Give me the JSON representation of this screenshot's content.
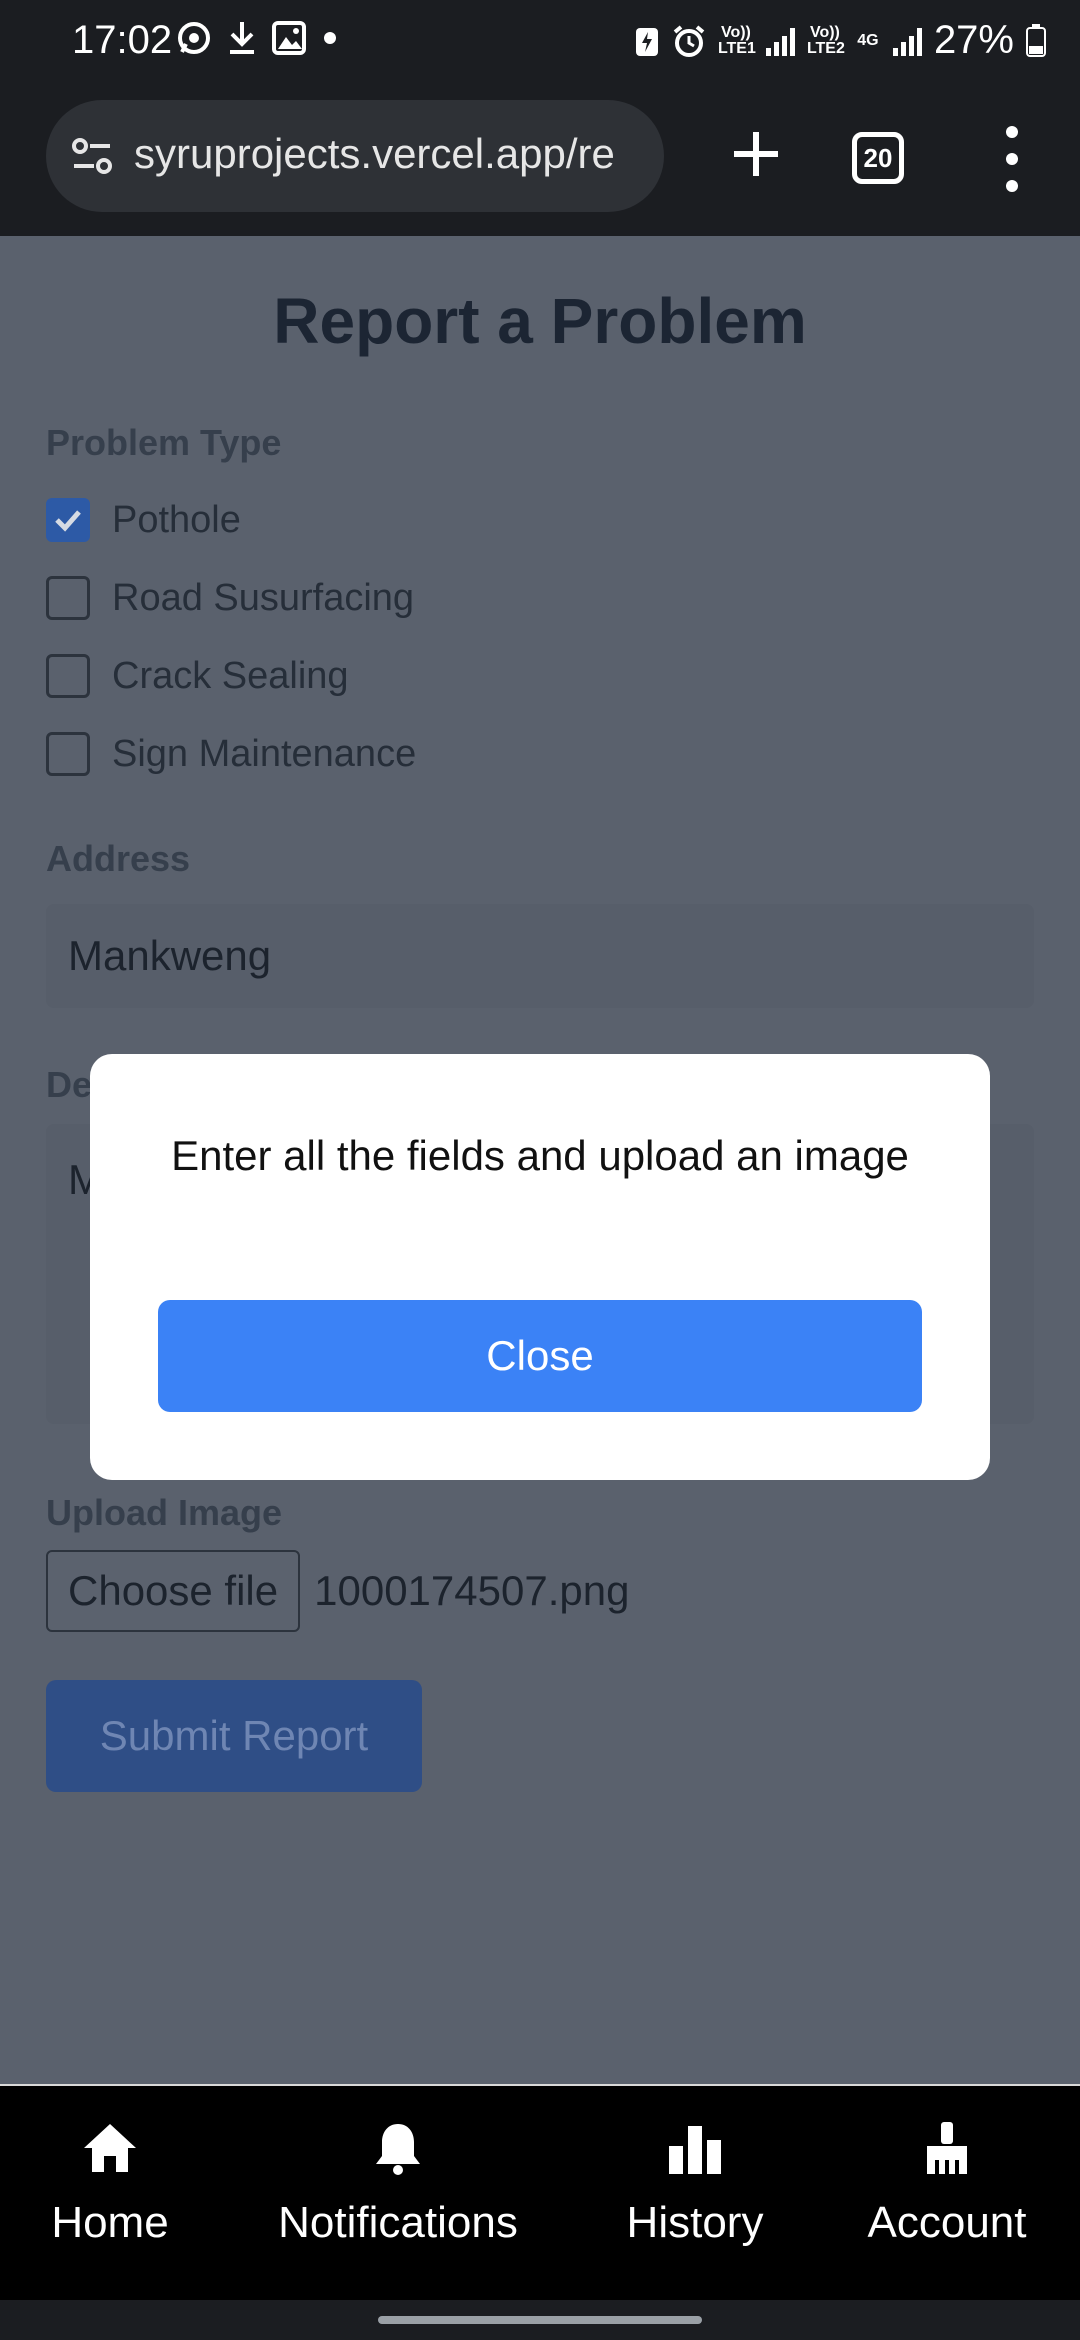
{
  "status_bar": {
    "time": "17:02",
    "battery": "27%",
    "net1": "Vo)) LTE1",
    "net2": "Vo)) LTE2",
    "net3": "4G"
  },
  "browser": {
    "url": "syruprojects.vercel.app/re",
    "tab_count": "20"
  },
  "form": {
    "title": "Report a Problem",
    "problem_type_label": "Problem Type",
    "options": [
      {
        "label": "Pothole",
        "checked": true
      },
      {
        "label": "Road Susurfacing",
        "checked": false
      },
      {
        "label": "Crack Sealing",
        "checked": false
      },
      {
        "label": "Sign Maintenance",
        "checked": false
      }
    ],
    "address_label": "Address",
    "address_value": "Mankweng",
    "description_label_visible": "De",
    "description_value_visible": "M",
    "upload_label": "Upload Image",
    "choose_file_label": "Choose file",
    "file_name": "1000174507.png",
    "submit_label": "Submit Report"
  },
  "modal": {
    "message": "Enter all the fields and upload an image",
    "close_label": "Close"
  },
  "bottom_nav": [
    {
      "label": "Home",
      "icon": "home-icon"
    },
    {
      "label": "Notifications",
      "icon": "bell-icon"
    },
    {
      "label": "History",
      "icon": "bar-chart-icon"
    },
    {
      "label": "Account",
      "icon": "broom-icon"
    }
  ]
}
